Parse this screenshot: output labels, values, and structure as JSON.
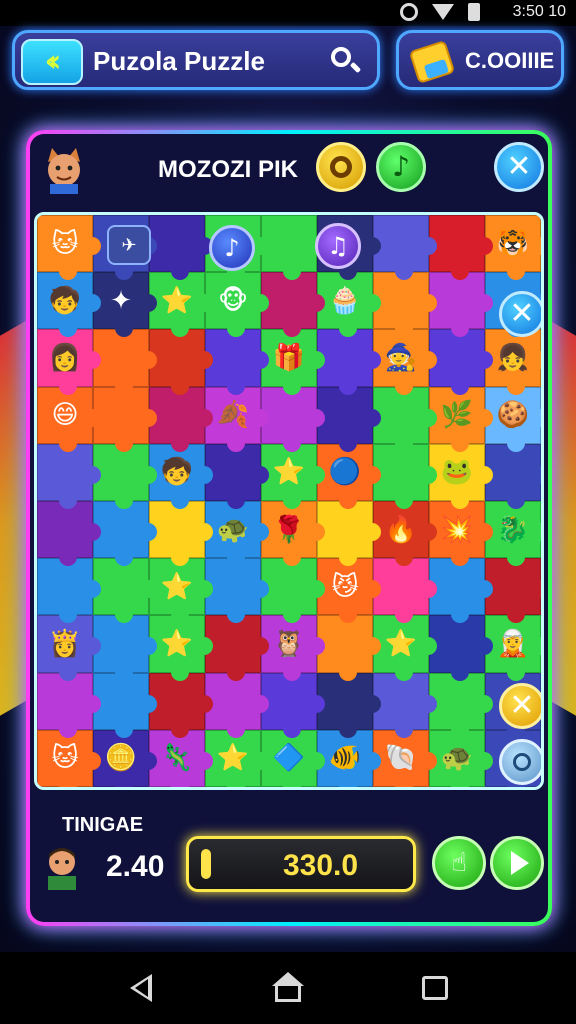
{
  "status_bar": {
    "time": "3:50 10",
    "icons": [
      "gear-icon",
      "wifi-icon",
      "battery-icon"
    ]
  },
  "header": {
    "back_icon": "double-chevron-left-icon",
    "title": "Puzola Puzzle",
    "search_icon": "search-icon"
  },
  "currency": {
    "icon": "coin-icon",
    "label": "C.OOIIIE"
  },
  "level": {
    "name": "MOZOZI PIK",
    "buttons": {
      "disc": "disc-icon",
      "music": "music-note-icon",
      "close": "close-icon"
    }
  },
  "board": {
    "columns": 9,
    "rows": 10,
    "pieces": [
      {
        "color": "#ff8a1e",
        "glyph": "🐱"
      },
      {
        "color": "#3b49b8",
        "glyph": ""
      },
      {
        "color": "#3c2aa8",
        "glyph": ""
      },
      {
        "color": "#34d84a",
        "glyph": ""
      },
      {
        "color": "#34d84a",
        "glyph": ""
      },
      {
        "color": "#2a2f7a",
        "glyph": ""
      },
      {
        "color": "#5a5ad8",
        "glyph": ""
      },
      {
        "color": "#d81e2a",
        "glyph": ""
      },
      {
        "color": "#ff8a1e",
        "glyph": "🐯"
      },
      {
        "color": "#2a8fe6",
        "glyph": "🧒"
      },
      {
        "color": "#2a2f7a",
        "glyph": "✦"
      },
      {
        "color": "#34d84a",
        "glyph": "⭐"
      },
      {
        "color": "#34d84a",
        "glyph": "🐵"
      },
      {
        "color": "#c01e6a",
        "glyph": ""
      },
      {
        "color": "#34d84a",
        "glyph": "🧁"
      },
      {
        "color": "#ff8a1e",
        "glyph": ""
      },
      {
        "color": "#b83ad8",
        "glyph": ""
      },
      {
        "color": "#2a8fe6",
        "glyph": ""
      },
      {
        "color": "#ff3d9a",
        "glyph": "👩"
      },
      {
        "color": "#ff6a1e",
        "glyph": ""
      },
      {
        "color": "#d8361e",
        "glyph": ""
      },
      {
        "color": "#5a3ad8",
        "glyph": ""
      },
      {
        "color": "#34d84a",
        "glyph": "🎁"
      },
      {
        "color": "#5a3ad8",
        "glyph": ""
      },
      {
        "color": "#ff8a1e",
        "glyph": "🧙"
      },
      {
        "color": "#5a3ad8",
        "glyph": ""
      },
      {
        "color": "#ff8a1e",
        "glyph": "👧"
      },
      {
        "color": "#ff6a1e",
        "glyph": "😄"
      },
      {
        "color": "#ff6a1e",
        "glyph": ""
      },
      {
        "color": "#c01e6a",
        "glyph": ""
      },
      {
        "color": "#c23ad8",
        "glyph": "🍂"
      },
      {
        "color": "#b83ad8",
        "glyph": ""
      },
      {
        "color": "#3c2aa8",
        "glyph": ""
      },
      {
        "color": "#34d84a",
        "glyph": ""
      },
      {
        "color": "#ff8a1e",
        "glyph": "🌿"
      },
      {
        "color": "#6ab8ff",
        "glyph": "🍪"
      },
      {
        "color": "#5a5ad8",
        "glyph": ""
      },
      {
        "color": "#34d84a",
        "glyph": ""
      },
      {
        "color": "#2a8fe6",
        "glyph": "🧒"
      },
      {
        "color": "#3c2aa8",
        "glyph": ""
      },
      {
        "color": "#34d84a",
        "glyph": "⭐"
      },
      {
        "color": "#ff6a1e",
        "glyph": "🔵"
      },
      {
        "color": "#34d84a",
        "glyph": ""
      },
      {
        "color": "#ffd21e",
        "glyph": "🐸"
      },
      {
        "color": "#3b49b8",
        "glyph": ""
      },
      {
        "color": "#7a2ab8",
        "glyph": ""
      },
      {
        "color": "#2a8fe6",
        "glyph": ""
      },
      {
        "color": "#ffd21e",
        "glyph": ""
      },
      {
        "color": "#2a8fe6",
        "glyph": "🐢"
      },
      {
        "color": "#ff8a1e",
        "glyph": "🌹"
      },
      {
        "color": "#ffd21e",
        "glyph": ""
      },
      {
        "color": "#d8361e",
        "glyph": "🔥"
      },
      {
        "color": "#ff6a1e",
        "glyph": "💥"
      },
      {
        "color": "#34d84a",
        "glyph": "🐉"
      },
      {
        "color": "#2a8fe6",
        "glyph": ""
      },
      {
        "color": "#34d84a",
        "glyph": ""
      },
      {
        "color": "#34d84a",
        "glyph": "⭐"
      },
      {
        "color": "#2a8fe6",
        "glyph": ""
      },
      {
        "color": "#34d84a",
        "glyph": ""
      },
      {
        "color": "#ff6a1e",
        "glyph": "😼"
      },
      {
        "color": "#ff3d9a",
        "glyph": ""
      },
      {
        "color": "#2a8fe6",
        "glyph": ""
      },
      {
        "color": "#c01e2a",
        "glyph": ""
      },
      {
        "color": "#5a5ad8",
        "glyph": "👸"
      },
      {
        "color": "#2a8fe6",
        "glyph": ""
      },
      {
        "color": "#34d84a",
        "glyph": "⭐"
      },
      {
        "color": "#c01e2a",
        "glyph": ""
      },
      {
        "color": "#b83ad8",
        "glyph": "🦉"
      },
      {
        "color": "#ff8a1e",
        "glyph": ""
      },
      {
        "color": "#34d84a",
        "glyph": "⭐"
      },
      {
        "color": "#2a3aa8",
        "glyph": ""
      },
      {
        "color": "#34d84a",
        "glyph": "🧝"
      },
      {
        "color": "#b83ad8",
        "glyph": ""
      },
      {
        "color": "#2a8fe6",
        "glyph": ""
      },
      {
        "color": "#c01e2a",
        "glyph": ""
      },
      {
        "color": "#b83ad8",
        "glyph": ""
      },
      {
        "color": "#5a3ad8",
        "glyph": ""
      },
      {
        "color": "#2a2f7a",
        "glyph": ""
      },
      {
        "color": "#5a5ad8",
        "glyph": ""
      },
      {
        "color": "#34d84a",
        "glyph": ""
      },
      {
        "color": "#3b49b8",
        "glyph": ""
      },
      {
        "color": "#ff6a1e",
        "glyph": "🐱"
      },
      {
        "color": "#3c2aa8",
        "glyph": "🪙"
      },
      {
        "color": "#b83ad8",
        "glyph": "🦎"
      },
      {
        "color": "#34d84a",
        "glyph": "⭐"
      },
      {
        "color": "#34d84a",
        "glyph": "🔷"
      },
      {
        "color": "#2a8fe6",
        "glyph": "🐠"
      },
      {
        "color": "#ff6a1e",
        "glyph": "🐚"
      },
      {
        "color": "#34d84a",
        "glyph": "🐢"
      },
      {
        "color": "#3b49b8",
        "glyph": ""
      }
    ],
    "overlay_buttons": {
      "plane": "plane-icon",
      "note1": "♪",
      "note2": "♫",
      "close2": "close-icon",
      "close_yellow": "close-icon",
      "user": "user-icon"
    }
  },
  "bottom": {
    "label": "TINIGAE",
    "value": "2.40",
    "score": "330.0",
    "score_progress": 0.05,
    "hint_icon": "hint-icon",
    "play_icon": "play-icon"
  },
  "colors": {
    "frame_glow_pink": "#ff3df2",
    "frame_glow_cyan": "#00f0ff",
    "score_yellow": "#ffe34a",
    "accent_green": "#34d84a"
  },
  "nav": {
    "back": "back-icon",
    "home": "home-icon",
    "recents": "recents-icon"
  }
}
